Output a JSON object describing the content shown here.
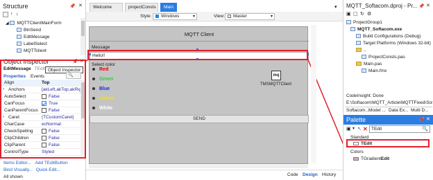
{
  "structure": {
    "title": "Structure",
    "items": [
      "MQTTClientMainForm",
      "BtnSend",
      "EditMessage",
      "LabelSelect",
      "MQTTclient"
    ]
  },
  "inspector": {
    "title": "Object Inspector",
    "component": "EditMessage",
    "component_type": "TEdit",
    "tooltip": "Object Inspector",
    "tabs": [
      "Properties",
      "Events"
    ],
    "rows": [
      {
        "name": "Align",
        "value": "Top",
        "check": "none"
      },
      {
        "name": "Anchors",
        "value": "[akLeft,akTop,akRight]",
        "check": "none"
      },
      {
        "name": "AutoSelect",
        "value": "False",
        "check": "unchecked"
      },
      {
        "name": "CanFocus",
        "value": "True",
        "check": "checked"
      },
      {
        "name": "CanParentFocus",
        "value": "False",
        "check": "unchecked"
      },
      {
        "name": "Caret",
        "value": "(TCustomCaret)",
        "check": "none"
      },
      {
        "name": "CharCase",
        "value": "ecNormal",
        "check": "none"
      },
      {
        "name": "CheckSpelling",
        "value": "False",
        "check": "unchecked"
      },
      {
        "name": "ClipChildren",
        "value": "False",
        "check": "unchecked"
      },
      {
        "name": "ClipParent",
        "value": "False",
        "check": "unchecked"
      },
      {
        "name": "ControlType",
        "value": "Styled",
        "check": "none"
      }
    ],
    "footer_links": [
      "Items Editor...",
      "Add TEditButton",
      "Bind Visually...",
      "Quick Edit..."
    ],
    "status": "All shown"
  },
  "editor_tabs": [
    "Welcome Page",
    "projectConsts",
    "Main"
  ],
  "toolbar": {
    "style_label": "Style:",
    "style_value": "Windows",
    "view_label": "View:",
    "view_value": "Master"
  },
  "form": {
    "title": "MQTT Client",
    "message_label": "Message",
    "edit_value": "Hello!!",
    "select_color_label": "Select color",
    "colors": [
      {
        "label": "Red",
        "color": "#e00000"
      },
      {
        "label": "Green",
        "color": "#2ecc40"
      },
      {
        "label": "Blue",
        "color": "#1030d0"
      },
      {
        "label": "Yellow",
        "color": "#f5e20a"
      },
      {
        "label": "White",
        "color": "#ffffff"
      }
    ],
    "component_glyph": "mq",
    "component_name": "TMSMQTTClient",
    "send_label": "SEND"
  },
  "bottom_tabs": [
    "Code",
    "Design",
    "History"
  ],
  "project": {
    "title": "MQTT_Softacom.dproj - Pr...",
    "items": [
      {
        "label": "ProjectGroup1",
        "bold": false
      },
      {
        "label": "MQTT_Softacom.exe",
        "bold": true
      },
      {
        "label": "Build Configurations (Debug)",
        "bold": false
      },
      {
        "label": "Target Platforms (Windows 32-bit)",
        "bold": false
      },
      {
        "label": "..",
        "bold": false
      },
      {
        "label": "ProjectConsts.pas",
        "bold": false
      },
      {
        "label": "Main.pas",
        "bold": false
      },
      {
        "label": "Main.fmx",
        "bold": false
      }
    ]
  },
  "codeinsight": {
    "status": "CodeInsight: Done",
    "path": "E:\\Softacom\\MQTT_Article\\MQTTFixed\\Softac...",
    "tabs": [
      "Softacom...",
      "Model ...",
      "Data Ex...",
      "Multi D..."
    ]
  },
  "palette": {
    "title": "Palette",
    "search": "TEdit",
    "category1": "Standard",
    "item1": "TEdit",
    "category2": "Colors",
    "item2_prefix": "TGradient",
    "item2_bold": "Edit"
  },
  "accent": "#2b7de1",
  "highlight": "#e0202c"
}
